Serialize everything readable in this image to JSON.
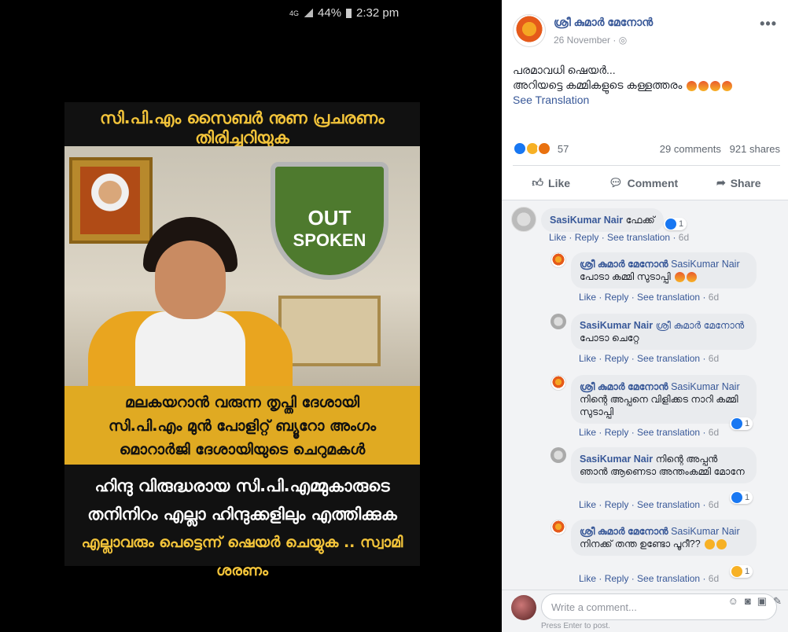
{
  "status_bar": {
    "network": "4G",
    "battery": "44%",
    "time": "2:32 pm"
  },
  "poster": {
    "headline": "സി.പി.എം സൈബർ നുണ പ്രചരണം തിരിച്ചറിയുക",
    "logo_line1": "OUT",
    "logo_line2": "SPOKEN",
    "band_lines": [
      "മലകയറാൻ വരുന്ന തൃപ്തി ദേശായി",
      "സി.പി.എം മുൻ പോളിറ്റ് ബ്യൂറോ അംഗം",
      "മൊറാർജി ദേശായിയുടെ ചെറുമകൾ"
    ],
    "lower_lines": [
      "ഹിന്ദു വിരുദ്ധരായ സി.പി.എമ്മുകാരുടെ",
      "തനിനിറം എല്ലാ ഹിന്ദുക്കളിലും എത്തിക്കുക"
    ],
    "footer_line": "എല്ലാവരും പെട്ടെന്ന് ഷെയർ ചെയ്യുക .. സ്വാമി ശരണം"
  },
  "post": {
    "author": "ശ്രീ കുമാർ മേനോൻ",
    "date": "26 November",
    "more_label": "•••",
    "text_line1": "പരമാവധി ഷെയർ...",
    "text_line2": "അറിയട്ടെ കമ്മികളുടെ കള്ളത്തരം",
    "see_translation": "See Translation",
    "reaction_count": "57",
    "comments_count": "29 comments",
    "shares_count": "921 shares",
    "actions": {
      "like": "Like",
      "comment": "Comment",
      "share": "Share"
    }
  },
  "comments": [
    {
      "name": "SasiKumar Nair",
      "tag": "",
      "text": "ഫേക്ക്",
      "likes": "1",
      "actions": {
        "like": "Like",
        "reply": "Reply",
        "see_translation": "See translation",
        "time": "6d"
      }
    },
    {
      "name": "ശ്രീ കുമാർ മേനോൻ",
      "tag": "SasiKumar Nair",
      "text": "പോടാ കമ്മി സുടാപ്പി",
      "likes": "",
      "actions": {
        "like": "Like",
        "reply": "Reply",
        "see_translation": "See translation",
        "time": "6d"
      }
    },
    {
      "name": "SasiKumar Nair",
      "tag": "ശ്രീ കുമാർ മേനോൻ",
      "text": "പോടാ ചെറ്റേ",
      "likes": "",
      "actions": {
        "like": "Like",
        "reply": "Reply",
        "see_translation": "See translation",
        "time": "6d"
      }
    },
    {
      "name": "ശ്രീ കുമാർ മേനോൻ",
      "tag": "SasiKumar Nair",
      "text": "നിന്റെ അപ്പനെ വിളിക്കട നാറി കമ്മി സുടാപ്പി",
      "likes": "1",
      "actions": {
        "like": "Like",
        "reply": "Reply",
        "see_translation": "See translation",
        "time": "6d"
      }
    },
    {
      "name": "SasiKumar Nair",
      "tag": "",
      "text": "നിന്റെ അപ്പൻ ഞാൻ ആണെടാ അന്തംകമ്മി മോനേ",
      "likes": "1",
      "actions": {
        "like": "Like",
        "reply": "Reply",
        "see_translation": "See translation",
        "time": "6d"
      }
    },
    {
      "name": "ശ്രീ കുമാർ മേനോൻ",
      "tag": "SasiKumar Nair",
      "text": "നിനക്ക് തന്ത ഉണ്ടോ പൂറീ??",
      "likes": "1",
      "actions": {
        "like": "Like",
        "reply": "Reply",
        "see_translation": "See translation",
        "time": "6d"
      }
    }
  ],
  "write_comment": {
    "placeholder": "Write a comment...",
    "hint": "Press Enter to post."
  },
  "colors": {
    "link": "#385898",
    "poster_gold": "#f3c43a",
    "band_gold": "#e0aa22"
  }
}
